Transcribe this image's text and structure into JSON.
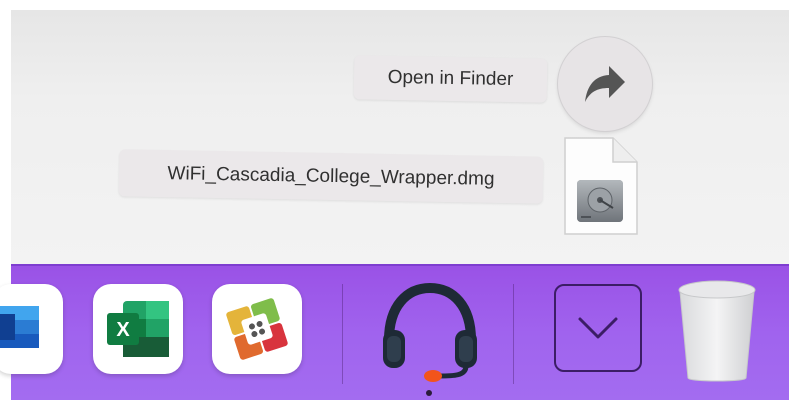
{
  "desktop": {
    "drop_menu": {
      "open_in_finder_label": "Open in Finder",
      "file_name": "WiFi_Cascadia_College_Wrapper.dmg"
    }
  },
  "dock": {
    "apps": [
      {
        "name": "word-app-icon"
      },
      {
        "name": "excel-app-icon",
        "letter": "X"
      },
      {
        "name": "app-hub-icon"
      },
      {
        "name": "headset-app-icon"
      },
      {
        "name": "downloads-stack-icon"
      },
      {
        "name": "trash-icon"
      }
    ]
  },
  "colors": {
    "dock_bg": "#a063ee",
    "excel_green": "#1f7a45",
    "headset_dark": "#1e2a36",
    "headset_mic": "#f2541b"
  }
}
